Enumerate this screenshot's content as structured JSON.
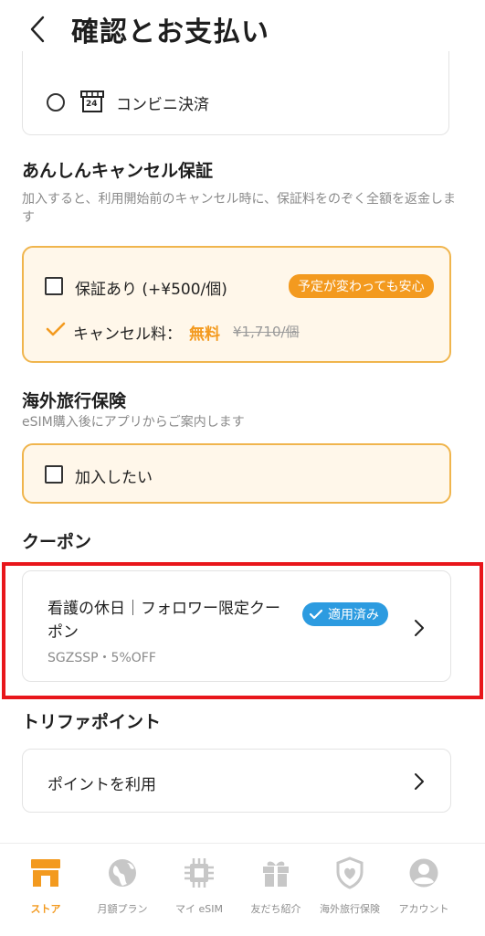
{
  "header": {
    "title": "確認とお支払い"
  },
  "payment": {
    "convenience_label": "コンビニ決済",
    "store_badge": "24"
  },
  "cancel_guarantee": {
    "title": "あんしんキャンセル保証",
    "description": "加入すると、利用開始前のキャンセル時に、保証料をのぞく全額を返金します",
    "option_label": "保証あり (+¥500/個)",
    "tag": "予定が変わっても安心",
    "fee_label": "キャンセル料：",
    "fee_free": "無料",
    "fee_original": "¥1,710/個"
  },
  "insurance": {
    "title": "海外旅行保険",
    "description": "eSIM購入後にアプリからご案内します",
    "option_label": "加入したい"
  },
  "coupon": {
    "title": "クーポン",
    "name_line1": "看護の休日｜フォロワー限定クー",
    "name_line2": "ポン",
    "code": "SGZSSP・5%OFF",
    "applied_badge": "適用済み"
  },
  "points": {
    "title": "トリファポイント",
    "use_label": "ポイントを利用"
  },
  "tabbar": {
    "tabs": [
      {
        "label": "ストア",
        "icon": "store-icon",
        "active": true
      },
      {
        "label": "月額プラン",
        "icon": "globe-icon",
        "active": false
      },
      {
        "label": "マイ eSIM",
        "icon": "chip-icon",
        "active": false
      },
      {
        "label": "友だち紹介",
        "icon": "gift-icon",
        "active": false
      },
      {
        "label": "海外旅行保険",
        "icon": "shield-heart-icon",
        "active": false
      },
      {
        "label": "アカウント",
        "icon": "account-icon",
        "active": false
      }
    ]
  },
  "colors": {
    "accent_orange": "#f39a1f",
    "option_bg": "#fff7ea",
    "option_border": "#f0b54d",
    "applied_blue": "#2c9be0",
    "highlight_red": "#e8161b"
  }
}
